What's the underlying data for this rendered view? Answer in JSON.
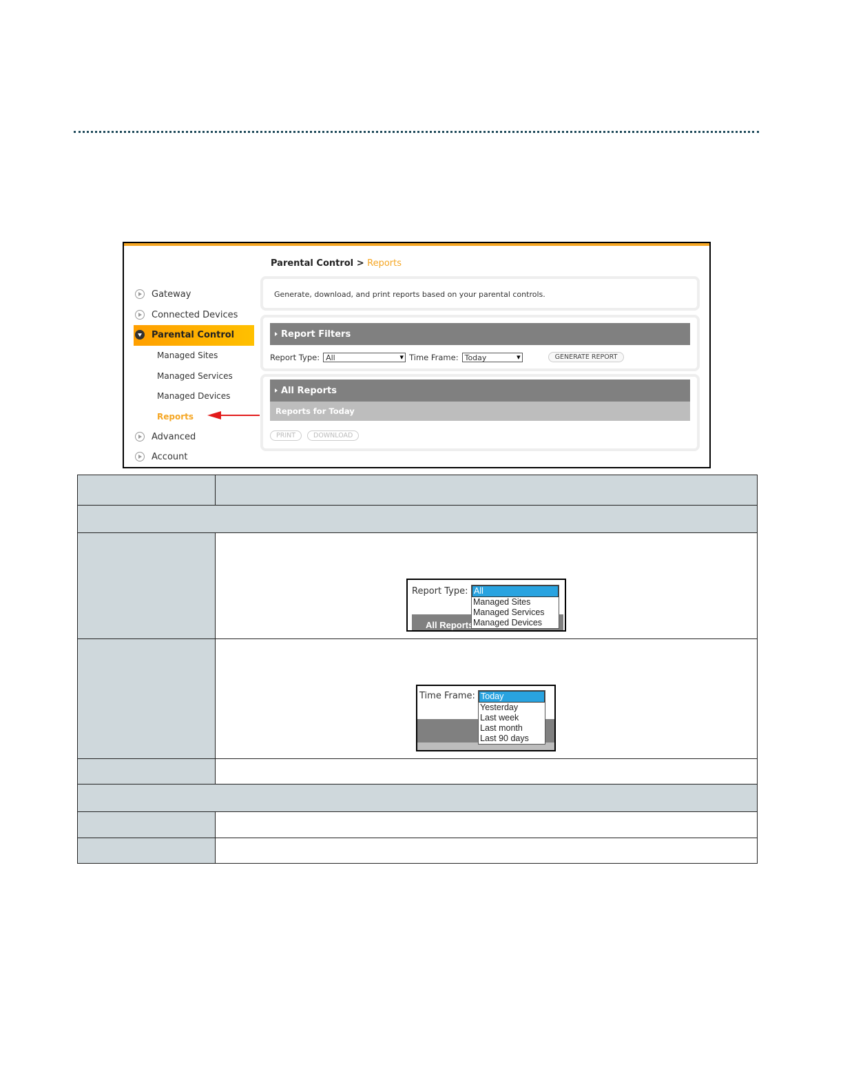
{
  "breadcrumb": {
    "parent": "Parental Control",
    "sep": ">",
    "current": "Reports"
  },
  "nav": {
    "gateway": "Gateway",
    "connected": "Connected Devices",
    "parental": "Parental Control",
    "managed_sites": "Managed Sites",
    "managed_services": "Managed Services",
    "managed_devices": "Managed Devices",
    "reports": "Reports",
    "advanced": "Advanced",
    "account": "Account"
  },
  "intro": "Generate, download, and print reports based on your parental controls.",
  "filters": {
    "title": "Report Filters",
    "report_type_label": "Report Type:",
    "report_type_value": "All",
    "time_frame_label": "Time Frame:",
    "time_frame_value": "Today",
    "generate_button": "GENERATE REPORT"
  },
  "reports": {
    "title": "All Reports",
    "subtitle": "Reports for Today",
    "print_button": "PRINT",
    "download_button": "DOWNLOAD"
  },
  "report_type_dropdown": {
    "label": "Report Type:",
    "options": [
      "All",
      "Managed Sites",
      "Managed Services",
      "Managed Devices"
    ],
    "bar_text": "All Reports"
  },
  "time_frame_dropdown": {
    "label": "Time Frame:",
    "options": [
      "Today",
      "Yesterday",
      "Last week",
      "Last month",
      "Last 90 days"
    ]
  },
  "colors": {
    "accent": "#f5a623",
    "header_gray": "#808080",
    "table_gray": "#cfd8dc",
    "select_blue": "#29a3e0"
  }
}
